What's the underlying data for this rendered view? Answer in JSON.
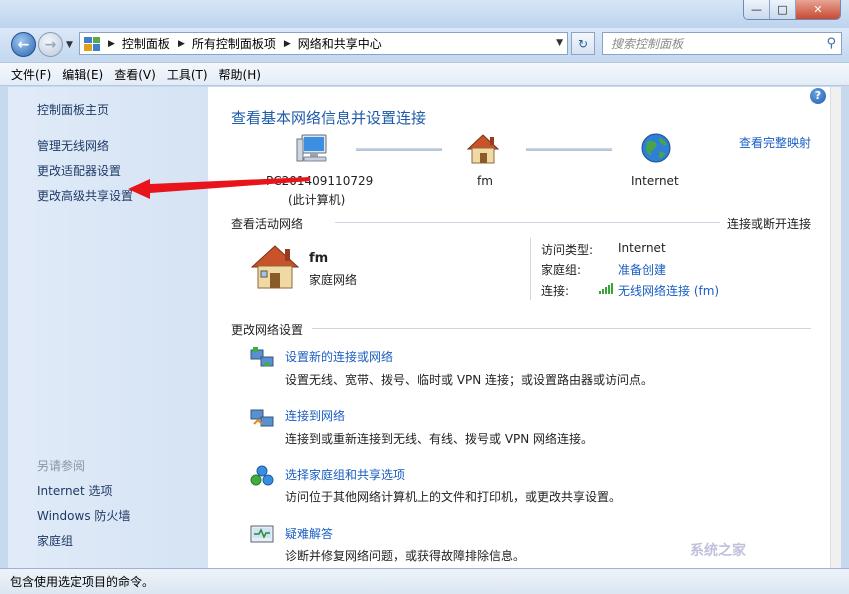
{
  "window": {
    "min_glyph": "—",
    "max_glyph": "□",
    "close_glyph": "✕"
  },
  "nav": {
    "back_glyph": "←",
    "forward_glyph": "→",
    "breadcrumbs": [
      "控制面板",
      "所有控制面板项",
      "网络和共享中心"
    ],
    "search_placeholder": "搜索控制面板",
    "refresh_glyph": "↻",
    "search_glyph": "⚲"
  },
  "menu": [
    "文件(F)",
    "编辑(E)",
    "查看(V)",
    "工具(T)",
    "帮助(H)"
  ],
  "sidebar": {
    "items": [
      "控制面板主页",
      "管理无线网络",
      "更改适配器设置",
      "更改高级共享设置"
    ],
    "see_also_heading": "另请参阅",
    "see_also": [
      "Internet 选项",
      "Windows 防火墙",
      "家庭组"
    ]
  },
  "main": {
    "title": "查看基本网络信息并设置连接",
    "full_map_link": "查看完整映射",
    "help_glyph": "?",
    "map": {
      "computer_name": "PC201409110729",
      "computer_sub": "(此计算机)",
      "network_name": "fm",
      "internet_label": "Internet"
    },
    "active": {
      "heading": "查看活动网络",
      "connect_link": "连接或断开连接",
      "network_name": "fm",
      "network_type": "家庭网络",
      "access_type_label": "访问类型:",
      "access_type_value": "Internet",
      "homegroup_label": "家庭组:",
      "homegroup_value": "准备创建",
      "connection_label": "连接:",
      "connection_value": "无线网络连接 (fm)"
    },
    "change": {
      "heading": "更改网络设置",
      "tasks": [
        {
          "link": "设置新的连接或网络",
          "desc": "设置无线、宽带、拨号、临时或 VPN 连接；或设置路由器或访问点。"
        },
        {
          "link": "连接到网络",
          "desc": "连接到或重新连接到无线、有线、拨号或 VPN 网络连接。"
        },
        {
          "link": "选择家庭组和共享选项",
          "desc": "访问位于其他网络计算机上的文件和打印机，或更改共享设置。"
        },
        {
          "link": "疑难解答",
          "desc": "诊断并修复网络问题，或获得故障排除信息。"
        }
      ]
    }
  },
  "status": {
    "text": "包含使用选定项目的命令。"
  },
  "annotation": {
    "arrow_color": "#e8141b"
  },
  "watermark": "系统之家"
}
